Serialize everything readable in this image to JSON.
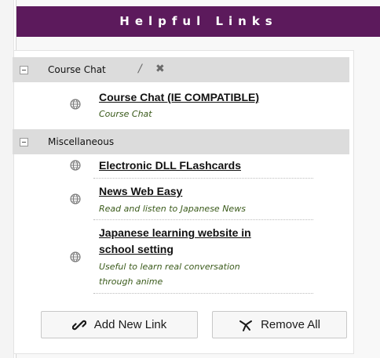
{
  "widget": {
    "title": "Helpful Links"
  },
  "categories": [
    {
      "label": "Course Chat"
    },
    {
      "label": "Miscellaneous"
    }
  ],
  "links": [
    {
      "title": "Course Chat (IE COMPATIBLE)",
      "description": "Course Chat"
    },
    {
      "title": "Electronic DLL FLashcards",
      "description": ""
    },
    {
      "title": "News Web Easy",
      "description": "Read and listen to Japanese News"
    },
    {
      "title_line1": "Japanese learning website in",
      "title_line2": "school setting",
      "description_line1": "Useful to learn real conversation",
      "description_line2": "through anime"
    }
  ],
  "buttons": {
    "add_label": "Add New Link",
    "remove_label": "Remove All"
  }
}
